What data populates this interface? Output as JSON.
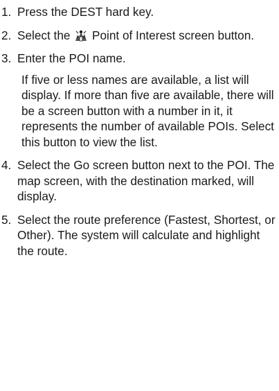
{
  "steps": [
    {
      "number": "1.",
      "text": "Press the DEST hard key."
    },
    {
      "number": "2.",
      "text_before": "Select the",
      "icon": "point-of-interest-icon",
      "text_after": "Point of Interest screen button."
    },
    {
      "number": "3.",
      "text": "Enter the POI name.",
      "note": "If five or less names are available, a list will display. If more than five are available, there will be a screen button with a number in it, it represents the number of available POIs. Select this button to view the list."
    },
    {
      "number": "4.",
      "text": "Select the Go screen button next to the POI. The map screen, with the destination marked, will display."
    },
    {
      "number": "5.",
      "text": "Select the route preference (Fastest, Shortest, or Other). The system will calculate and highlight the route."
    }
  ]
}
